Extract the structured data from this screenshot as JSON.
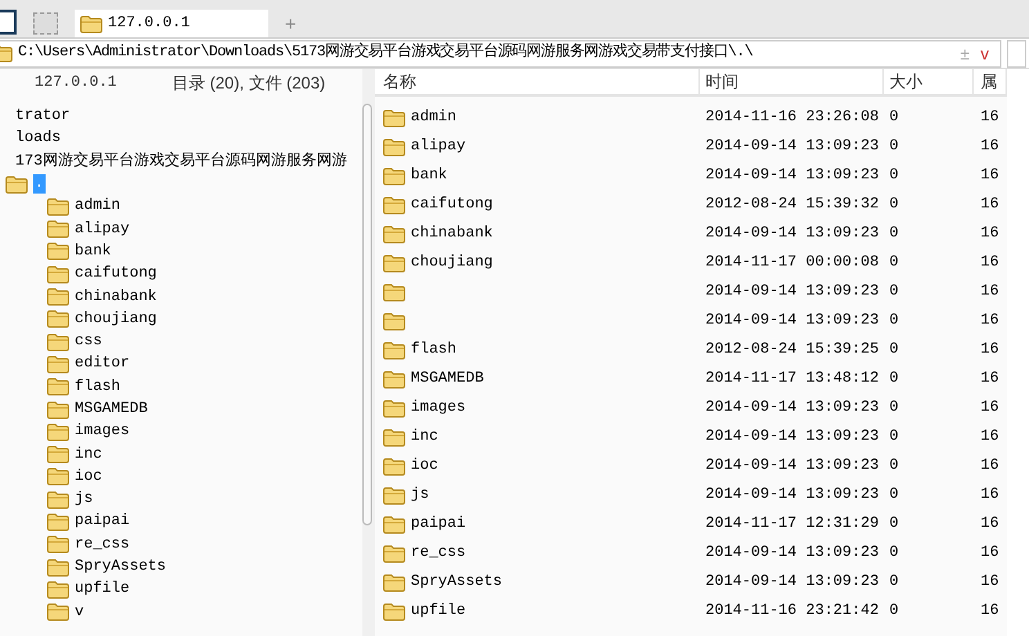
{
  "tabs": [
    {
      "label": "127.0.0.1",
      "selected": true
    }
  ],
  "new_tab": "+",
  "address_bar": {
    "path": "C:\\Users\\Administrator\\Downloads\\5173网游交易平台游戏交易平台源码网游服务网游戏交易带支付接口\\.\\",
    "buttons": [
      "±",
      "v"
    ]
  },
  "left_header": {
    "host": "127.0.0.1",
    "summary": "目录 (20), 文件 (203)"
  },
  "tree": [
    {
      "label": "trator",
      "children": [
        {
          "label": "loads",
          "children": [
            {
              "label": "173网游交易平台游戏交易平台源码网游服务网游",
              "children": [
                {
                  "label": ".",
                  "selected": true,
                  "children": [
                    {
                      "label": "admin",
                      "selected": false
                    },
                    {
                      "label": "alipay",
                      "selected": false
                    },
                    {
                      "label": "bank",
                      "selected": false
                    },
                    {
                      "label": "caifutong",
                      "selected": false
                    },
                    {
                      "label": "chinabank",
                      "selected": false
                    },
                    {
                      "label": "choujiang",
                      "selected": false
                    },
                    {
                      "label": "css",
                      "selected": false
                    },
                    {
                      "label": "editor",
                      "selected": false
                    },
                    {
                      "label": "flash",
                      "selected": false
                    },
                    {
                      "label": "MSGAMEDB",
                      "selected": false
                    },
                    {
                      "label": "images",
                      "selected": false
                    },
                    {
                      "label": "inc",
                      "selected": false
                    },
                    {
                      "label": "ioc",
                      "selected": false
                    },
                    {
                      "label": "js",
                      "selected": false
                    },
                    {
                      "label": "paipai",
                      "selected": false
                    },
                    {
                      "label": "re_css",
                      "selected": false
                    },
                    {
                      "label": "SpryAssets",
                      "selected": false
                    },
                    {
                      "label": "upfile",
                      "selected": false
                    },
                    {
                      "label": "v",
                      "selected": false
                    }
                  ]
                }
              ]
            }
          ]
        }
      ]
    }
  ],
  "table": {
    "columns": [
      "名称",
      "时间",
      "大小",
      "属"
    ],
    "rows": [
      {
        "name": "admin",
        "time": "2014-11-16 23:26:08",
        "size": "0",
        "attr": "16"
      },
      {
        "name": "alipay",
        "time": "2014-09-14 13:09:23",
        "size": "0",
        "attr": "16"
      },
      {
        "name": "bank",
        "time": "2014-09-14 13:09:23",
        "size": "0",
        "attr": "16"
      },
      {
        "name": "caifutong",
        "time": "2012-08-24 15:39:32",
        "size": "0",
        "attr": "16"
      },
      {
        "name": "chinabank",
        "time": "2014-09-14 13:09:23",
        "size": "0",
        "attr": "16"
      },
      {
        "name": "choujiang",
        "time": "2014-11-17 00:00:08",
        "size": "0",
        "attr": "16"
      },
      {
        "time": "2014-09-14 13:09:23",
        "size": "0",
        "attr": "16"
      },
      {
        "time": "2014-09-14 13:09:23",
        "size": "0",
        "attr": "16"
      },
      {
        "name": "flash",
        "time": "2012-08-24 15:39:25",
        "size": "0",
        "attr": "16"
      },
      {
        "name": "MSGAMEDB",
        "time": "2014-11-17 13:48:12",
        "size": "0",
        "attr": "16"
      },
      {
        "name": "images",
        "time": "2014-09-14 13:09:23",
        "size": "0",
        "attr": "16"
      },
      {
        "name": "inc",
        "time": "2014-09-14 13:09:23",
        "size": "0",
        "attr": "16"
      },
      {
        "name": "ioc",
        "time": "2014-09-14 13:09:23",
        "size": "0",
        "attr": "16"
      },
      {
        "name": "js",
        "time": "2014-09-14 13:09:23",
        "size": "0",
        "attr": "16"
      },
      {
        "name": "paipai",
        "time": "2014-11-17 12:31:29",
        "size": "0",
        "attr": "16"
      },
      {
        "name": "re_css",
        "time": "2014-09-14 13:09:23",
        "size": "0",
        "attr": "16"
      },
      {
        "name": "SpryAssets",
        "time": "2014-09-14 13:09:23",
        "size": "0",
        "attr": "16"
      },
      {
        "name": "upfile",
        "time": "2014-11-16 23:21:42",
        "size": "0",
        "attr": "16"
      }
    ]
  }
}
